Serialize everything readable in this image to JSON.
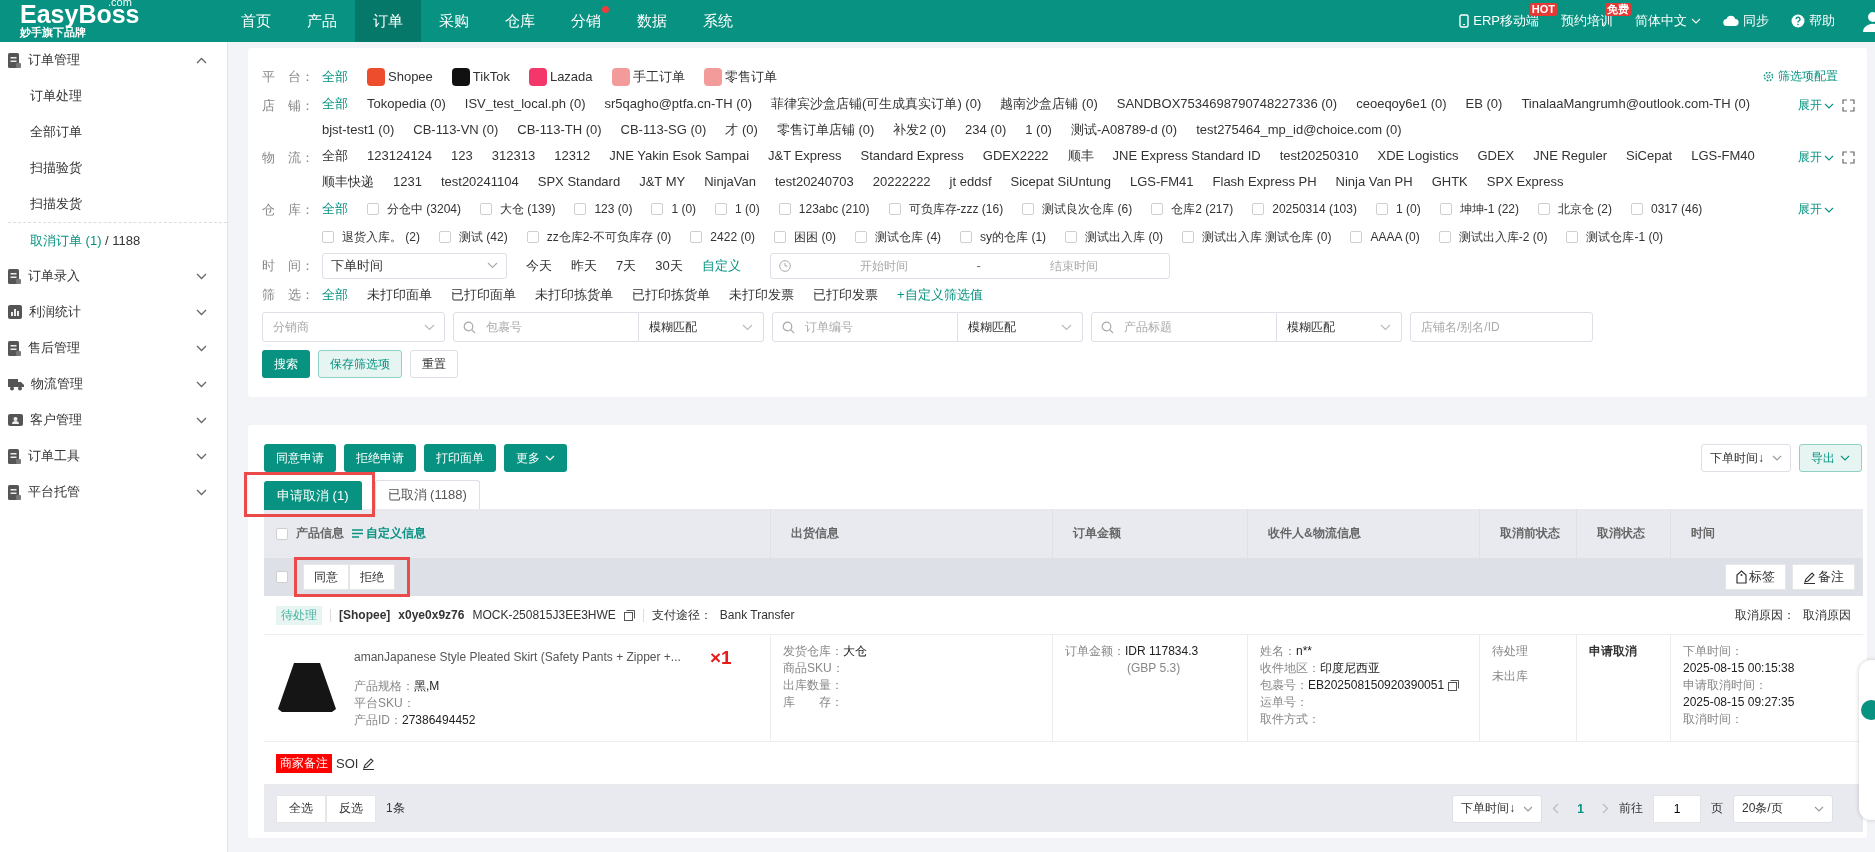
{
  "brand": {
    "name": "EasyBoss",
    "domain": ".com",
    "tagline": "妙手旗下品牌"
  },
  "nav": [
    {
      "label": "首页",
      "selected": false,
      "dot": false
    },
    {
      "label": "产品",
      "selected": false,
      "dot": false
    },
    {
      "label": "订单",
      "selected": true,
      "dot": false
    },
    {
      "label": "采购",
      "selected": false,
      "dot": false
    },
    {
      "label": "仓库",
      "selected": false,
      "dot": false
    },
    {
      "label": "分销",
      "selected": false,
      "dot": true
    },
    {
      "label": "数据",
      "selected": false,
      "dot": false
    },
    {
      "label": "系统",
      "selected": false,
      "dot": false
    }
  ],
  "header_actions": [
    {
      "kind": "mobile",
      "label": "ERP移动端",
      "badge": "HOT"
    },
    {
      "kind": "plain",
      "label": "预约培训",
      "badge": "免费"
    },
    {
      "kind": "language",
      "label": "简体中文"
    },
    {
      "kind": "sync",
      "label": "同步"
    },
    {
      "kind": "help",
      "label": "帮助"
    }
  ],
  "sidebar": {
    "items": [
      {
        "label": "订单管理",
        "expanded": true,
        "children": [
          {
            "label": "订单处理",
            "selected": false
          },
          {
            "label": "全部订单",
            "selected": false
          },
          {
            "label": "扫描验货",
            "selected": false
          },
          {
            "label": "扫描发货",
            "selected": false
          },
          {
            "label": "取消订单 (1)",
            "count": "/ 1188",
            "selected": true
          }
        ]
      },
      {
        "label": "订单录入",
        "expanded": false
      },
      {
        "label": "利润统计",
        "expanded": false
      },
      {
        "label": "售后管理",
        "expanded": false
      },
      {
        "label": "物流管理",
        "expanded": false
      },
      {
        "label": "客户管理",
        "expanded": false
      },
      {
        "label": "订单工具",
        "expanded": false
      },
      {
        "label": "平台托管",
        "expanded": false
      }
    ]
  },
  "filters": {
    "rows": [
      {
        "kind": "platform",
        "label": "平　台：",
        "config": "筛选项配置",
        "all": {
          "text": "全部",
          "selected": true
        },
        "options": [
          {
            "text": "Shopee",
            "color": "#ee4d2d",
            "selected": false
          },
          {
            "text": "TikTok",
            "color": "#111111",
            "selected": false
          },
          {
            "text": "Lazada",
            "color": "#f4376b",
            "selected": false
          },
          {
            "text": "手工订单",
            "color": "#f39a9a",
            "selected": false
          },
          {
            "text": "零售订单",
            "color": "#f39a9a",
            "selected": false
          }
        ]
      },
      {
        "kind": "links",
        "label": "店　铺：",
        "expand": "展开",
        "fold_icon": true,
        "all": {
          "text": "全部",
          "selected": true
        },
        "options": [
          {
            "text": "Tokopedia (0)",
            "selected": false
          },
          {
            "text": "ISV_test_local.ph (0)",
            "selected": false
          },
          {
            "text": "sr5qagho@ptfa.cn-TH (0)",
            "selected": false
          },
          {
            "text": "菲律宾沙盒店铺(可生成真实订单) (0)",
            "selected": false
          },
          {
            "text": "越南沙盒店铺 (0)",
            "selected": false
          },
          {
            "text": "SANDBOX7534698790748227336 (0)",
            "selected": false
          },
          {
            "text": "ceoeqoy6e1 (0)",
            "selected": false
          },
          {
            "text": "EB (0)",
            "selected": false
          },
          {
            "text": "TinalaaMangrumh@outlook.com-TH (0)",
            "selected": false
          },
          {
            "text": "bjst-test1 (0)",
            "selected": false
          },
          {
            "text": "CB-113-VN (0)",
            "selected": false
          },
          {
            "text": "CB-113-TH (0)",
            "selected": false
          },
          {
            "text": "CB-113-SG (0)",
            "selected": false
          },
          {
            "text": "才 (0)",
            "selected": false
          },
          {
            "text": "零售订单店铺 (0)",
            "selected": false
          },
          {
            "text": "补发2 (0)",
            "selected": false
          },
          {
            "text": "234 (0)",
            "selected": false
          },
          {
            "text": "1 (0)",
            "selected": false
          },
          {
            "text": "测试-A08789-d (0)",
            "selected": false
          },
          {
            "text": "test275464_mp_id@choice.com (0)",
            "selected": false
          }
        ]
      },
      {
        "kind": "links",
        "label": "物　流：",
        "expand": "展开",
        "fold_icon": true,
        "all": {
          "text": "全部",
          "selected": false
        },
        "options": [
          {
            "text": "123124124",
            "selected": false
          },
          {
            "text": "123",
            "selected": false
          },
          {
            "text": "312313",
            "selected": false
          },
          {
            "text": "12312",
            "selected": false
          },
          {
            "text": "JNE Yakin Esok Sampai",
            "selected": false
          },
          {
            "text": "J&T Express",
            "selected": false
          },
          {
            "text": "Standard Express",
            "selected": false
          },
          {
            "text": "GDEX2222",
            "selected": false
          },
          {
            "text": "顺丰",
            "selected": false
          },
          {
            "text": "JNE Express Standard ID",
            "selected": false
          },
          {
            "text": "test20250310",
            "selected": false
          },
          {
            "text": "XDE Logistics",
            "selected": false
          },
          {
            "text": "GDEX",
            "selected": false
          },
          {
            "text": "JNE Reguler",
            "selected": false
          },
          {
            "text": "SiCepat",
            "selected": false
          },
          {
            "text": "LGS-FM40",
            "selected": false
          },
          {
            "text": "顺丰快递",
            "selected": false
          },
          {
            "text": "1231",
            "selected": false
          },
          {
            "text": "test20241104",
            "selected": false
          },
          {
            "text": "SPX Standard",
            "selected": false
          },
          {
            "text": "J&T MY",
            "selected": false
          },
          {
            "text": "NinjaVan",
            "selected": false
          },
          {
            "text": "test20240703",
            "selected": false
          },
          {
            "text": "20222222",
            "selected": false
          },
          {
            "text": "jt eddsf",
            "selected": false
          },
          {
            "text": "Sicepat SiUntung",
            "selected": false
          },
          {
            "text": "LGS-FM41",
            "selected": false
          },
          {
            "text": "Flash Express PH",
            "selected": false
          },
          {
            "text": "Ninja Van PH",
            "selected": false
          },
          {
            "text": "GHTK",
            "selected": false
          },
          {
            "text": "SPX Express",
            "selected": false
          }
        ]
      },
      {
        "kind": "checks",
        "label": "仓　库：",
        "expand": "展开",
        "all": {
          "text": "全部",
          "selected": true
        },
        "options": [
          {
            "text": "分仓中 (3204)",
            "checked": false
          },
          {
            "text": "大仓 (139)",
            "checked": false
          },
          {
            "text": "123 (0)",
            "checked": false
          },
          {
            "text": "1 (0)",
            "checked": false
          },
          {
            "text": "1 (0)",
            "checked": false
          },
          {
            "text": "123abc (210)",
            "checked": false
          },
          {
            "text": "可负库存-zzz (16)",
            "checked": false
          },
          {
            "text": "测试良次仓库 (6)",
            "checked": false
          },
          {
            "text": "仓库2 (217)",
            "checked": false
          },
          {
            "text": "20250314 (103)",
            "checked": false
          },
          {
            "text": "1 (0)",
            "checked": false
          },
          {
            "text": "坤坤-1 (22)",
            "checked": false
          },
          {
            "text": "北京仓 (2)",
            "checked": false
          },
          {
            "text": "0317 (46)",
            "checked": false
          },
          {
            "text": "退货入库。 (2)",
            "checked": false
          },
          {
            "text": "测试 (42)",
            "checked": false
          },
          {
            "text": "zz仓库2-不可负库存 (0)",
            "checked": false
          },
          {
            "text": "2422 (0)",
            "checked": false
          },
          {
            "text": "困困 (0)",
            "checked": false
          },
          {
            "text": "测试仓库 (4)",
            "checked": false
          },
          {
            "text": "sy的仓库 (1)",
            "checked": false
          },
          {
            "text": "测试出入库 (0)",
            "checked": false
          },
          {
            "text": "测试出入库 测试仓库 (0)",
            "checked": false
          },
          {
            "text": "AAAA (0)",
            "checked": false
          },
          {
            "text": "测试出入库-2 (0)",
            "checked": false
          },
          {
            "text": "测试仓库-1 (0)",
            "checked": false
          }
        ]
      },
      {
        "kind": "time",
        "label": "时　间：",
        "select": "下单时间",
        "options": [
          {
            "text": "今天",
            "selected": false
          },
          {
            "text": "昨天",
            "selected": false
          },
          {
            "text": "7天",
            "selected": false
          },
          {
            "text": "30天",
            "selected": false
          },
          {
            "text": "自定义",
            "selected": true
          }
        ],
        "range": {
          "start": {
            "placeholder": "开始时间"
          },
          "separator": "-",
          "end": {
            "placeholder": "结束时间"
          }
        }
      },
      {
        "kind": "links",
        "label": "筛　选：",
        "custom": "+自定义筛选值",
        "all": {
          "text": "全部",
          "selected": true
        },
        "options": [
          {
            "text": "未打印面单",
            "selected": false
          },
          {
            "text": "已打印面单",
            "selected": false
          },
          {
            "text": "未打印拣货单",
            "selected": false
          },
          {
            "text": "已打印拣货单",
            "selected": false
          },
          {
            "text": "未打印发票",
            "selected": false
          },
          {
            "text": "已打印发票",
            "selected": false
          }
        ]
      }
    ],
    "search_fields": [
      {
        "kind": "select",
        "placeholder": "分销商"
      },
      {
        "kind": "search",
        "placeholder": "包裹号",
        "match": "模糊匹配"
      },
      {
        "kind": "search",
        "placeholder": "订单编号",
        "match": "模糊匹配"
      },
      {
        "kind": "search",
        "placeholder": "产品标题",
        "match": "模糊匹配"
      },
      {
        "kind": "input",
        "placeholder": "店铺名/别名/ID"
      }
    ],
    "buttons": [
      {
        "kind": "primary",
        "label": "搜索"
      },
      {
        "kind": "light",
        "label": "保存筛选项"
      },
      {
        "kind": "plain",
        "label": "重置"
      }
    ]
  },
  "toolbar": {
    "buttons": [
      {
        "label": "同意申请",
        "caret": false
      },
      {
        "label": "拒绝申请",
        "caret": false
      },
      {
        "label": "打印面单",
        "caret": false
      },
      {
        "label": "更多",
        "caret": true
      }
    ],
    "sort": "下单时间↓",
    "export": "导出"
  },
  "tabs": [
    {
      "label": "申请取消 (1)",
      "selected": true,
      "highlighted": true
    },
    {
      "label": "已取消 (1188)",
      "selected": false,
      "highlighted": false
    }
  ],
  "table": {
    "select_all_checked": false,
    "custom_link": "自定义信息",
    "columns": [
      "产品信息",
      "出货信息",
      "订单金额",
      "收件人&物流信息",
      "取消前状态",
      "取消状态",
      "时间"
    ]
  },
  "row_actions": {
    "checked": false,
    "buttons": [
      "同意",
      "拒绝"
    ],
    "highlighted": true,
    "tools": [
      "标签",
      "备注"
    ]
  },
  "order": {
    "status": "待处理",
    "platform": "[Shopee]",
    "buyer": "x0ye0x9z76",
    "order_no": "MOCK-250815J3EE3HWE",
    "payment_label": "支付途径：",
    "payment": "Bank Transfer",
    "cancel_reason_label": "取消原因：",
    "cancel_reason": "取消原因",
    "product": {
      "title": "amanJapanese Style Pleated Skirt (Safety Pants + Zipper +...",
      "quantity": "×1",
      "fields": [
        {
          "label": "产品规格：",
          "value": "黑,M"
        },
        {
          "label": "平台SKU："
        },
        {
          "label": "产品ID：",
          "value": "27386494452"
        }
      ]
    },
    "shipping": [
      {
        "label": "发货仓库：",
        "value": "大仓"
      },
      {
        "label": "商品SKU："
      },
      {
        "label": "出库数量："
      },
      {
        "label": "库　　存："
      }
    ],
    "amount": {
      "label": "订单金额：",
      "value": "IDR 117834.3",
      "sub": "(GBP 5.3)"
    },
    "recipient": [
      {
        "label": "姓名：",
        "value": "n**"
      },
      {
        "label": "收件地区：",
        "value": "印度尼西亚"
      },
      {
        "label": "包裹号：",
        "value": "EB202508150920390051",
        "copy": true
      },
      {
        "label": "运单号："
      },
      {
        "label": "取件方式："
      }
    ],
    "pre_status": [
      "待处理",
      "未出库"
    ],
    "cancel_status": "申请取消",
    "times": [
      {
        "label": "下单时间：",
        "value": "2025-08-15 00:15:38"
      },
      {
        "label": "申请取消时间：",
        "value": "2025-08-15 09:27:35"
      },
      {
        "label": "取消时间："
      }
    ],
    "remark": {
      "tag": "商家备注",
      "text": "SOI"
    }
  },
  "footer": {
    "buttons": [
      "全选",
      "反选"
    ],
    "count": "1条",
    "sort": "下单时间↓",
    "pages": [
      {
        "label": "1",
        "selected": true
      }
    ],
    "goto": "前往",
    "page_input": "1",
    "page_unit": "页",
    "page_size": "20条/页"
  }
}
